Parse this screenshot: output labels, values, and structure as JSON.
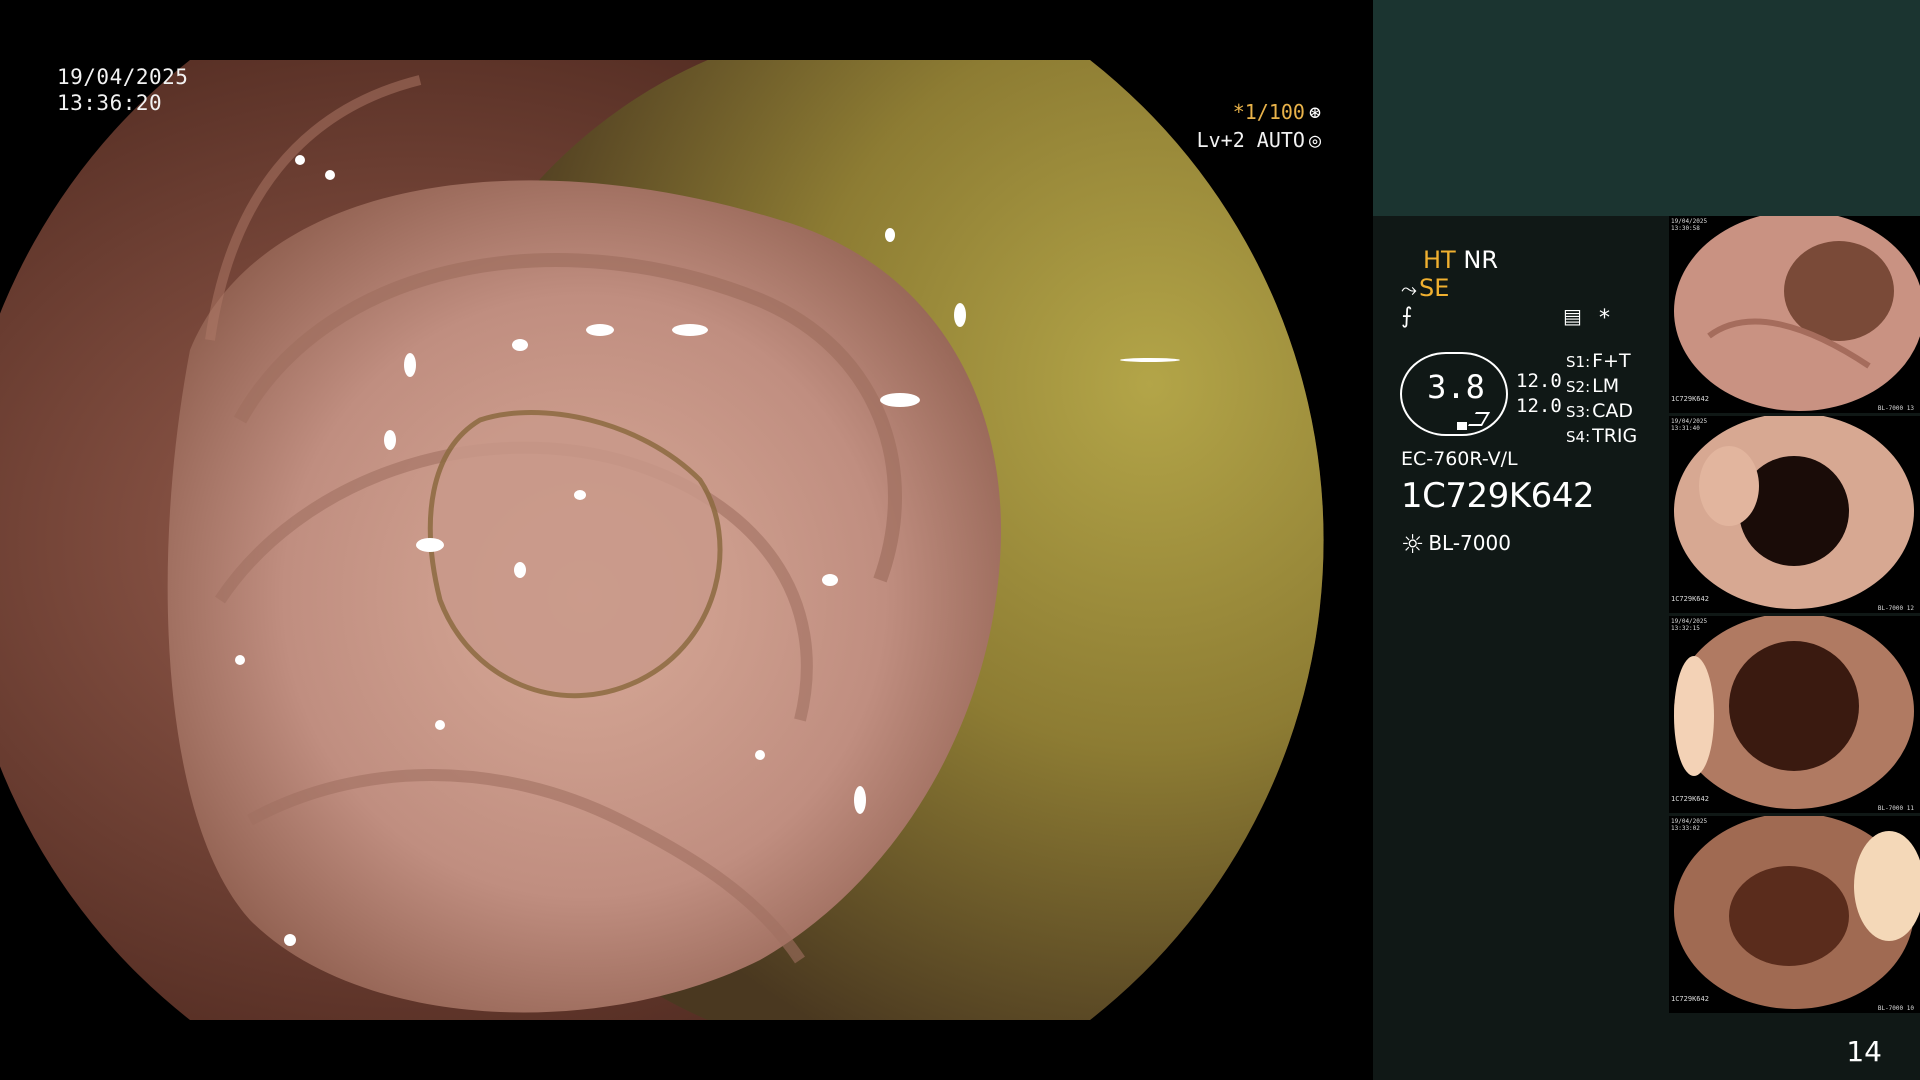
{
  "overlay": {
    "date": "19/04/2025",
    "time": "13:36:20",
    "shutter": "*1/100",
    "shutter_icon": "aperture-icon",
    "level": "Lv+2 AUTO",
    "level_icon": "iris-icon"
  },
  "status": {
    "ht": "HT",
    "nr": "NR",
    "se": "SE",
    "f_symbol": "⨍",
    "menu_symbol": "▤",
    "star": "*",
    "gauge_value": "3.8",
    "readout_1": "12.0",
    "readout_2": "12.0",
    "switches": [
      {
        "key": "S1:",
        "value": "F+T"
      },
      {
        "key": "S2:",
        "value": "LM"
      },
      {
        "key": "S3:",
        "value": "CAD"
      },
      {
        "key": "S4:",
        "value": "TRIG"
      }
    ],
    "scope_model": "EC-760R-V/L",
    "scope_serial": "1C729K642",
    "light_source": "BL-7000",
    "light_icon": "lamp-icon"
  },
  "thumbnails": [
    {
      "date": "19/04/2025",
      "time": "13:30:58",
      "serial": "1C729K642",
      "foot": "BL-7000",
      "num": "13"
    },
    {
      "date": "19/04/2025",
      "time": "13:31:40",
      "serial": "1C729K642",
      "foot": "BL-7000",
      "num": "12"
    },
    {
      "date": "19/04/2025",
      "time": "13:32:15",
      "serial": "1C729K642",
      "foot": "BL-7000",
      "num": "11"
    },
    {
      "date": "19/04/2025",
      "time": "13:33:02",
      "serial": "1C729K642",
      "foot": "BL-7000",
      "num": "10"
    }
  ],
  "page_number": "14",
  "colors": {
    "background": "#000000",
    "panel": "#101816",
    "panel_top": "#1b3430",
    "highlight": "#f0b030",
    "mucosa": "#c48e80",
    "fluid": "#8a7a30"
  }
}
